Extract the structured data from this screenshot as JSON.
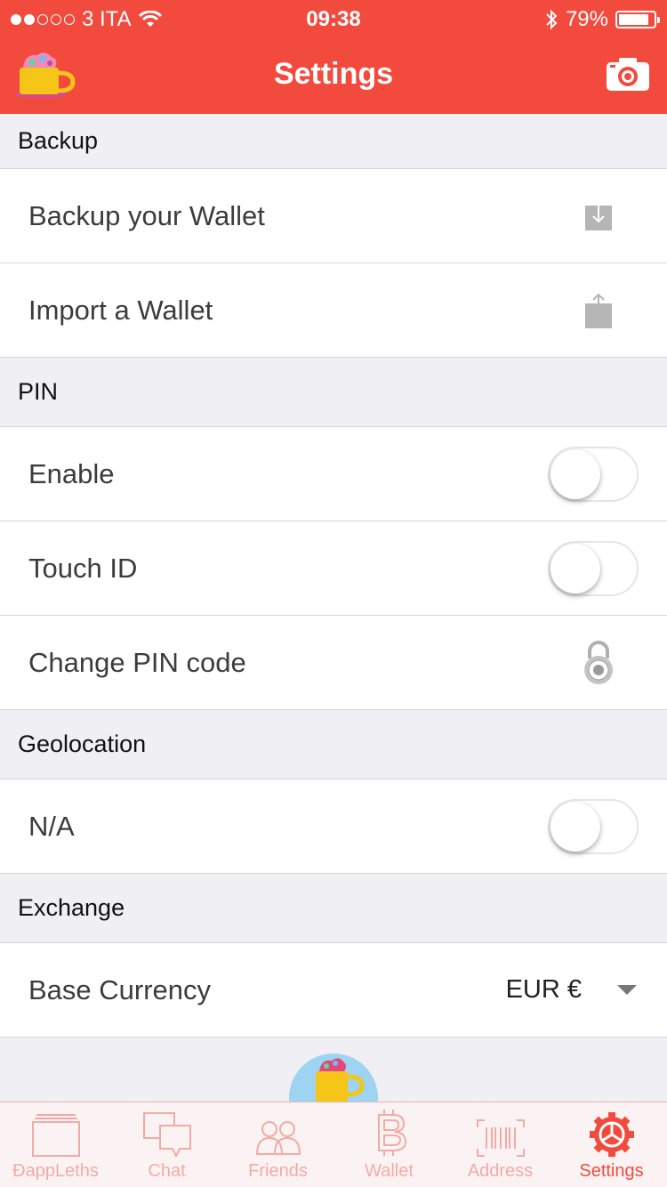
{
  "status_bar": {
    "carrier": "3 ITA",
    "time": "09:38",
    "battery": "79%",
    "signal_bars_filled": 2,
    "signal_bars_total": 5
  },
  "nav": {
    "title": "Settings",
    "left_icon": "mug-logo-icon",
    "right_icon": "camera-icon"
  },
  "sections": {
    "backup": {
      "header": "Backup",
      "backup_wallet": "Backup your Wallet",
      "import_wallet": "Import a Wallet"
    },
    "pin": {
      "header": "PIN",
      "enable": "Enable",
      "enable_on": false,
      "touch_id": "Touch ID",
      "touch_id_on": false,
      "change_pin": "Change PIN code"
    },
    "geolocation": {
      "header": "Geolocation",
      "value": "N/A",
      "value_on": false
    },
    "exchange": {
      "header": "Exchange",
      "base_currency": "Base Currency",
      "currency_value": "EUR €"
    }
  },
  "tabs": [
    {
      "label": "ÐappLeths",
      "icon": "folder-icon",
      "active": false
    },
    {
      "label": "Chat",
      "icon": "chat-bubbles-icon",
      "active": false
    },
    {
      "label": "Friends",
      "icon": "friends-icon",
      "active": false
    },
    {
      "label": "Wallet",
      "icon": "bitcoin-icon",
      "active": false
    },
    {
      "label": "Address",
      "icon": "barcode-icon",
      "active": false
    },
    {
      "label": "Settings",
      "icon": "gear-icon",
      "active": true
    }
  ],
  "colors": {
    "brand_red": "#f24a3d",
    "tab_inactive": "#f2aba4",
    "background": "#efeff4"
  }
}
